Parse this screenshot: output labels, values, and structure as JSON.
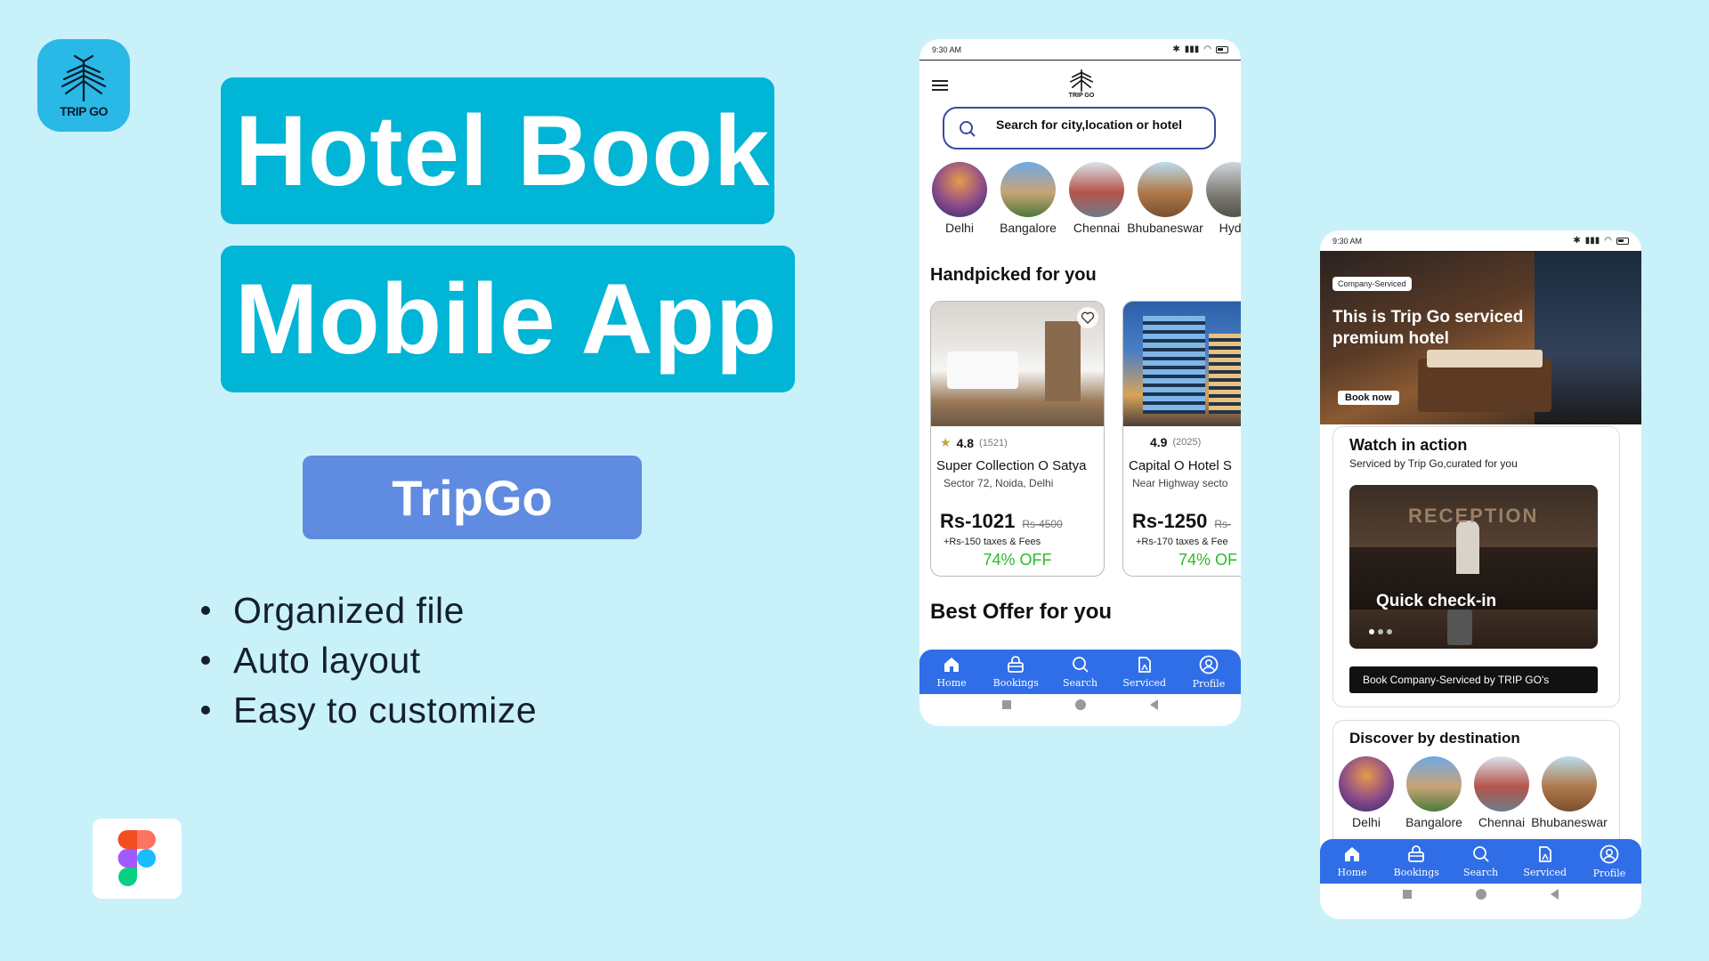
{
  "promo": {
    "logo_text": "TRIP GO",
    "title_line1": "Hotel Book",
    "title_line2": "Mobile App",
    "brand_pill": "TripGo",
    "features": [
      "Organized file",
      "Auto layout",
      "Easy to customize"
    ]
  },
  "phone1": {
    "status_time": "9:30 AM",
    "logo_text": "TRIP GO",
    "search_placeholder": "Search for city,location or hotel",
    "cities": [
      "Delhi",
      "Bangalore",
      "Chennai",
      "Bhubaneswar",
      "Hyde"
    ],
    "handpicked_title": "Handpicked for you",
    "hotels": [
      {
        "rating": "4.8",
        "reviews": "(1521)",
        "name": "Super Collection O Satya",
        "address": "Sector 72, Noida, Delhi",
        "price": "Rs-1021",
        "old_price": "Rs-4500",
        "taxes": "+Rs-150 taxes & Fees",
        "discount": "74% OFF"
      },
      {
        "rating": "4.9",
        "reviews": "(2025)",
        "name": "Capital O Hotel S",
        "address": "Near Highway secto",
        "price": "Rs-1250",
        "old_price": "Rs-",
        "taxes": "+Rs-170 taxes & Fee",
        "discount": "74% OF"
      }
    ],
    "best_offer_title": "Best Offer for you"
  },
  "tabs": [
    "Home",
    "Bookings",
    "Search",
    "Serviced",
    "Profile"
  ],
  "phone2": {
    "status_time": "9:30 AM",
    "hero_badge": "Company-Serviced",
    "hero_headline": "This is Trip Go serviced premium hotel",
    "hero_button": "Book now",
    "watch_title": "Watch in action",
    "watch_subtitle": "Serviced by Trip Go,curated for you",
    "video_caption": "Quick check-in",
    "video_sign": "RECEPTION",
    "cta_button": "Book Company-Serviced by TRIP GO's",
    "discover_title": "Discover by destination",
    "cities": [
      "Delhi",
      "Bangalore",
      "Chennai",
      "Bhubaneswar"
    ]
  },
  "colors": {
    "background": "#c9f1fa",
    "title_box": "#00b5d6",
    "pill": "#5f8be0",
    "tabbar": "#2f6ee6",
    "discount": "#2db82d"
  }
}
